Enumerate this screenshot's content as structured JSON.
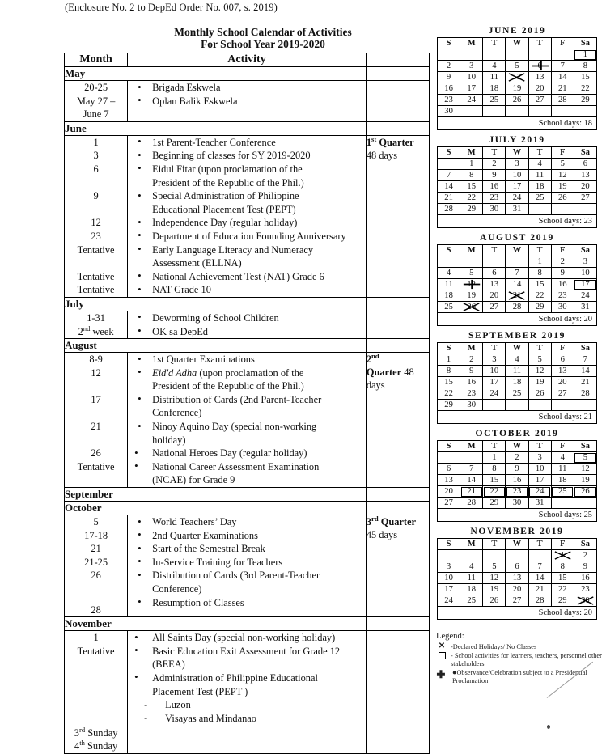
{
  "enclosure": "(Enclosure No. 2 to DepEd Order No. 007, s. 2019)",
  "doc": {
    "title_line1": "Monthly School Calendar of Activities",
    "title_line2": "For School Year 2019-2020",
    "headers": {
      "month": "Month",
      "activity": "Activity",
      "quarter": ""
    },
    "months": [
      {
        "band": "May",
        "dates": [
          "20-25",
          "May 27 –",
          "June 7"
        ],
        "activities": [
          "Brigada Eskwela",
          "Oplan Balik Eskwela"
        ],
        "quarter": ""
      },
      {
        "band": "June",
        "dates": [
          "1",
          "3",
          "6",
          "",
          "9",
          "",
          "12",
          "23",
          "Tentative",
          "",
          "Tentative",
          "Tentative"
        ],
        "activities": [
          "1st  Parent-Teacher Conference",
          "Beginning of classes for SY 2019-2020",
          "Eidul Fitar (upon proclamation of the",
          "President of the Republic of the Phil.)",
          "Special Administration of  Philippine",
          "Educational Placement Test (PEPT)",
          "Independence Day (regular holiday)",
          "Department of Education Founding Anniversary",
          "Early Language Literacy and Numeracy",
          "Assessment (ELLNA)",
          "National Achievement Test (NAT) Grade 6",
          "NAT Grade 10"
        ],
        "quarter_label": "1st Quarter",
        "quarter_days": "48 days"
      },
      {
        "band": "July",
        "dates": [
          "1-31",
          "2nd week"
        ],
        "activities": [
          "Deworming of School Children",
          "OK sa DepEd"
        ],
        "quarter": ""
      },
      {
        "band": "August",
        "dates": [
          "8-9",
          "12",
          "",
          "17",
          "",
          "21",
          "",
          "26",
          "Tentative",
          ""
        ],
        "activities": [
          "1st Quarter Examinations",
          "Eid'd Adha (upon proclamation of the",
          "President of the Republic of the Phil.)",
          "Distribution of Cards  (2nd Parent-Teacher",
          "Conference)",
          "Ninoy Aquino Day (special non-working",
          "holiday)",
          "National Heroes Day  (regular holiday)",
          "National Career Assessment Examination",
          "(NCAE) for Grade 9"
        ],
        "quarter_label_a": "2nd",
        "quarter_label_b": "Quarter 48",
        "quarter_label_c": "days"
      },
      {
        "band": "September",
        "dates": [],
        "activities": [],
        "quarter": ""
      },
      {
        "band": "October",
        "dates": [
          "5",
          "17-18",
          "21",
          "21-25",
          "26",
          "",
          "28"
        ],
        "activities": [
          "World Teachers’ Day",
          "2nd Quarter Examinations",
          "Start of the Semestral Break",
          "In-Service Training for Teachers",
          "Distribution of Cards (3rd Parent-Teacher",
          "Conference)",
          "Resumption of Classes"
        ],
        "quarter_label": "3rd Quarter",
        "quarter_days": "45 days"
      },
      {
        "band": "November",
        "dates": [
          "1",
          "Tentative",
          "",
          "",
          "",
          "",
          "3rd Sunday",
          "4th Sunday"
        ],
        "activities": [
          "All Saints Day (special non-working holiday)",
          "Basic Education Exit Assessment for Grade 12",
          "(BEEA)",
          "Administration of Philippine Educational",
          "Placement Test (PEPT )",
          "Luzon",
          "Visayas and Mindanao"
        ],
        "quarter": ""
      }
    ]
  },
  "calendars": [
    {
      "title": "JUNE 2019",
      "weekdays": [
        "S",
        "M",
        "T",
        "W",
        "T",
        "F",
        "Sa"
      ],
      "weeks": [
        [
          "",
          "",
          "",
          "",
          "",
          "",
          "1"
        ],
        [
          "2",
          "3",
          "4",
          "5",
          "6",
          "7",
          "8"
        ],
        [
          "9",
          "10",
          "11",
          "12",
          "13",
          "14",
          "15"
        ],
        [
          "16",
          "17",
          "18",
          "19",
          "20",
          "21",
          "22"
        ],
        [
          "23",
          "24",
          "25",
          "26",
          "27",
          "28",
          "29"
        ],
        [
          "30",
          "",
          "",
          "",
          "",
          "",
          ""
        ]
      ],
      "marks": {
        "1": "box",
        "6": "plus",
        "12": "x"
      },
      "school_days": "School days: 18"
    },
    {
      "title": "JULY 2019",
      "weekdays": [
        "S",
        "M",
        "T",
        "W",
        "T",
        "F",
        "Sa"
      ],
      "weeks": [
        [
          "",
          "1",
          "2",
          "3",
          "4",
          "5",
          "6"
        ],
        [
          "7",
          "8",
          "9",
          "10",
          "11",
          "12",
          "13"
        ],
        [
          "14",
          "15",
          "16",
          "17",
          "18",
          "19",
          "20"
        ],
        [
          "21",
          "22",
          "23",
          "24",
          "25",
          "26",
          "27"
        ],
        [
          "28",
          "29",
          "30",
          "31",
          "",
          "",
          ""
        ]
      ],
      "marks": {},
      "school_days": "School days: 23"
    },
    {
      "title": "AUGUST 2019",
      "weekdays": [
        "S",
        "M",
        "T",
        "W",
        "T",
        "F",
        "Sa"
      ],
      "weeks": [
        [
          "",
          "",
          "",
          "",
          "1",
          "2",
          "3"
        ],
        [
          "4",
          "5",
          "6",
          "7",
          "8",
          "9",
          "10"
        ],
        [
          "11",
          "12",
          "13",
          "14",
          "15",
          "16",
          "17"
        ],
        [
          "18",
          "19",
          "20",
          "21",
          "22",
          "23",
          "24"
        ],
        [
          "25",
          "26",
          "27",
          "28",
          "29",
          "30",
          "31"
        ]
      ],
      "marks": {
        "12": "plus",
        "17": "box",
        "21": "x",
        "26": "x"
      },
      "school_days": "School days: 20"
    },
    {
      "title": "SEPTEMBER 2019",
      "weekdays": [
        "S",
        "M",
        "T",
        "W",
        "T",
        "F",
        "Sa"
      ],
      "weeks": [
        [
          "1",
          "2",
          "3",
          "4",
          "5",
          "6",
          "7"
        ],
        [
          "8",
          "9",
          "10",
          "11",
          "12",
          "13",
          "14"
        ],
        [
          "15",
          "16",
          "17",
          "18",
          "19",
          "20",
          "21"
        ],
        [
          "22",
          "23",
          "24",
          "25",
          "26",
          "27",
          "28"
        ],
        [
          "29",
          "30",
          "",
          "",
          "",
          "",
          ""
        ]
      ],
      "marks": {},
      "school_days": "School days: 21"
    },
    {
      "title": "OCTOBER 2019",
      "weekdays": [
        "S",
        "M",
        "T",
        "W",
        "T",
        "F",
        "Sa"
      ],
      "weeks": [
        [
          "",
          "",
          "1",
          "2",
          "3",
          "4",
          "5"
        ],
        [
          "6",
          "7",
          "8",
          "9",
          "10",
          "11",
          "12"
        ],
        [
          "13",
          "14",
          "15",
          "16",
          "17",
          "18",
          "19"
        ],
        [
          "20",
          "21",
          "22",
          "23",
          "24",
          "25",
          "26"
        ],
        [
          "27",
          "28",
          "29",
          "30",
          "31",
          "",
          ""
        ]
      ],
      "marks": {
        "5": "box",
        "21": "box",
        "22": "box",
        "23": "box",
        "24": "box",
        "25": "box",
        "26": "box"
      },
      "school_days": "School days: 25"
    },
    {
      "title": "NOVEMBER 2019",
      "weekdays": [
        "S",
        "M",
        "T",
        "W",
        "T",
        "F",
        "Sa"
      ],
      "weeks": [
        [
          "",
          "",
          "",
          "",
          "",
          "1",
          "2"
        ],
        [
          "3",
          "4",
          "5",
          "6",
          "7",
          "8",
          "9"
        ],
        [
          "10",
          "11",
          "12",
          "13",
          "14",
          "15",
          "16"
        ],
        [
          "17",
          "18",
          "19",
          "20",
          "21",
          "22",
          "23"
        ],
        [
          "24",
          "25",
          "26",
          "27",
          "28",
          "29",
          "30"
        ]
      ],
      "marks": {
        "1": "x",
        "30": "x"
      },
      "school_days": "School days: 20"
    }
  ],
  "legend": {
    "title": "Legend:",
    "items": [
      {
        "icon": "x-mark-icon",
        "text": "-Declared Holidays/ No Classes"
      },
      {
        "icon": "square-icon",
        "text": "-  School activities for learners, teachers, personnel other stakeholders"
      },
      {
        "icon": "plus-dot-icon",
        "text": "Observance/Celebration subject to a Presidential Proclamation"
      }
    ]
  }
}
